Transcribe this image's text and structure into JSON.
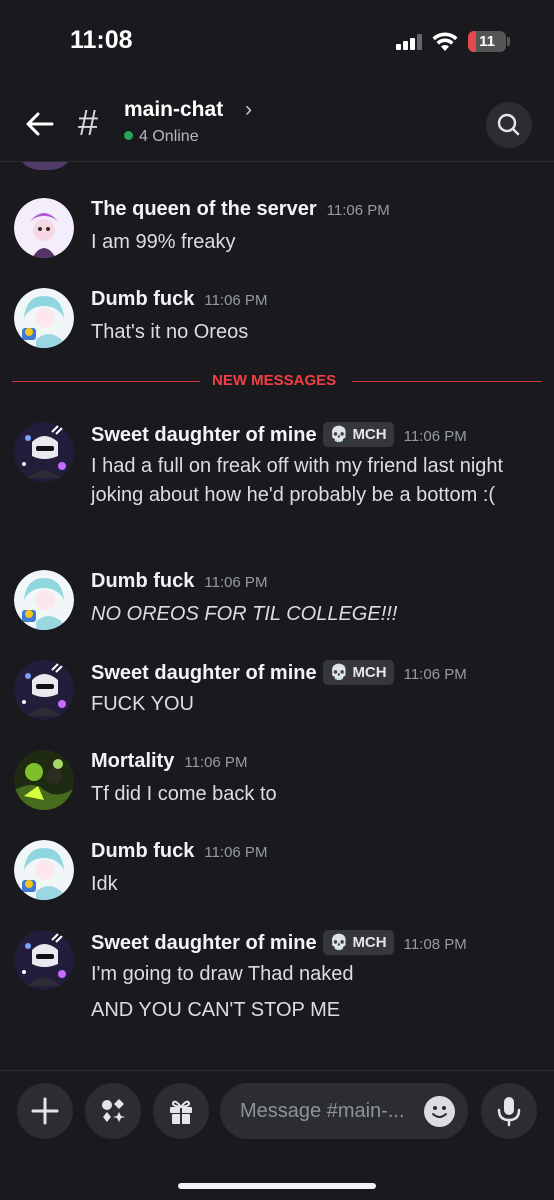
{
  "status_bar": {
    "time": "11:08",
    "battery_level": "11",
    "battery_fraction": 0.11,
    "icons": [
      "cellular-signal-icon",
      "wifi-icon",
      "battery-icon"
    ]
  },
  "header": {
    "channel_name": "main-chat",
    "chevron": "›",
    "online_count": "4 Online",
    "icons": [
      "back-arrow-icon",
      "hash-icon",
      "search-icon"
    ]
  },
  "messages": [
    {
      "author": "The queen of the server",
      "tag": "",
      "time": "11:06 PM",
      "lines": [
        "I am 99% freaky"
      ],
      "italic": false,
      "avatar_color": "#e7d3ff"
    },
    {
      "author": "Dumb fuck",
      "tag": "",
      "time": "11:06 PM",
      "lines": [
        "That's it no Oreos"
      ],
      "italic": false,
      "avatar_color": "#bfe9f0"
    },
    {
      "author": "Sweet daughter of mine",
      "tag": "💀 MCH",
      "time": "11:06 PM",
      "lines": [
        "I had a full on freak off with my friend last night joking about how he'd probably be a bottom :("
      ],
      "italic": false,
      "avatar_color": "#3a2f5a"
    },
    {
      "author": "Dumb fuck",
      "tag": "",
      "time": "11:06 PM",
      "lines": [
        "NO OREOS FOR TIL COLLEGE!!!"
      ],
      "italic": true,
      "avatar_color": "#bfe9f0"
    },
    {
      "author": "Sweet daughter of mine",
      "tag": "💀 MCH",
      "time": "11:06 PM",
      "lines": [
        "FUCK YOU"
      ],
      "italic": false,
      "avatar_color": "#3a2f5a"
    },
    {
      "author": "Mortality",
      "tag": "",
      "time": "11:06 PM",
      "lines": [
        "Tf did I come back to"
      ],
      "italic": false,
      "avatar_color": "#3d5a1f"
    },
    {
      "author": "Dumb fuck",
      "tag": "",
      "time": "11:06 PM",
      "lines": [
        "Idk"
      ],
      "italic": false,
      "avatar_color": "#bfe9f0"
    },
    {
      "author": "Sweet daughter of mine",
      "tag": "💀 MCH",
      "time": "11:08 PM",
      "lines": [
        "I'm going to draw Thad naked",
        "AND YOU CAN'T STOP ME"
      ],
      "italic": false,
      "avatar_color": "#3a2f5a"
    }
  ],
  "divider": {
    "label": "NEW MESSAGES",
    "color": "#f23f43"
  },
  "composer": {
    "placeholder": "Message #main-...",
    "icons": [
      "plus-icon",
      "apps-icon",
      "gift-icon",
      "emoji-icon",
      "microphone-icon"
    ]
  },
  "colors": {
    "background": "#1a1a1e",
    "surface": "#2b2d31",
    "online": "#23a55a",
    "accent_red": "#f23f43"
  }
}
